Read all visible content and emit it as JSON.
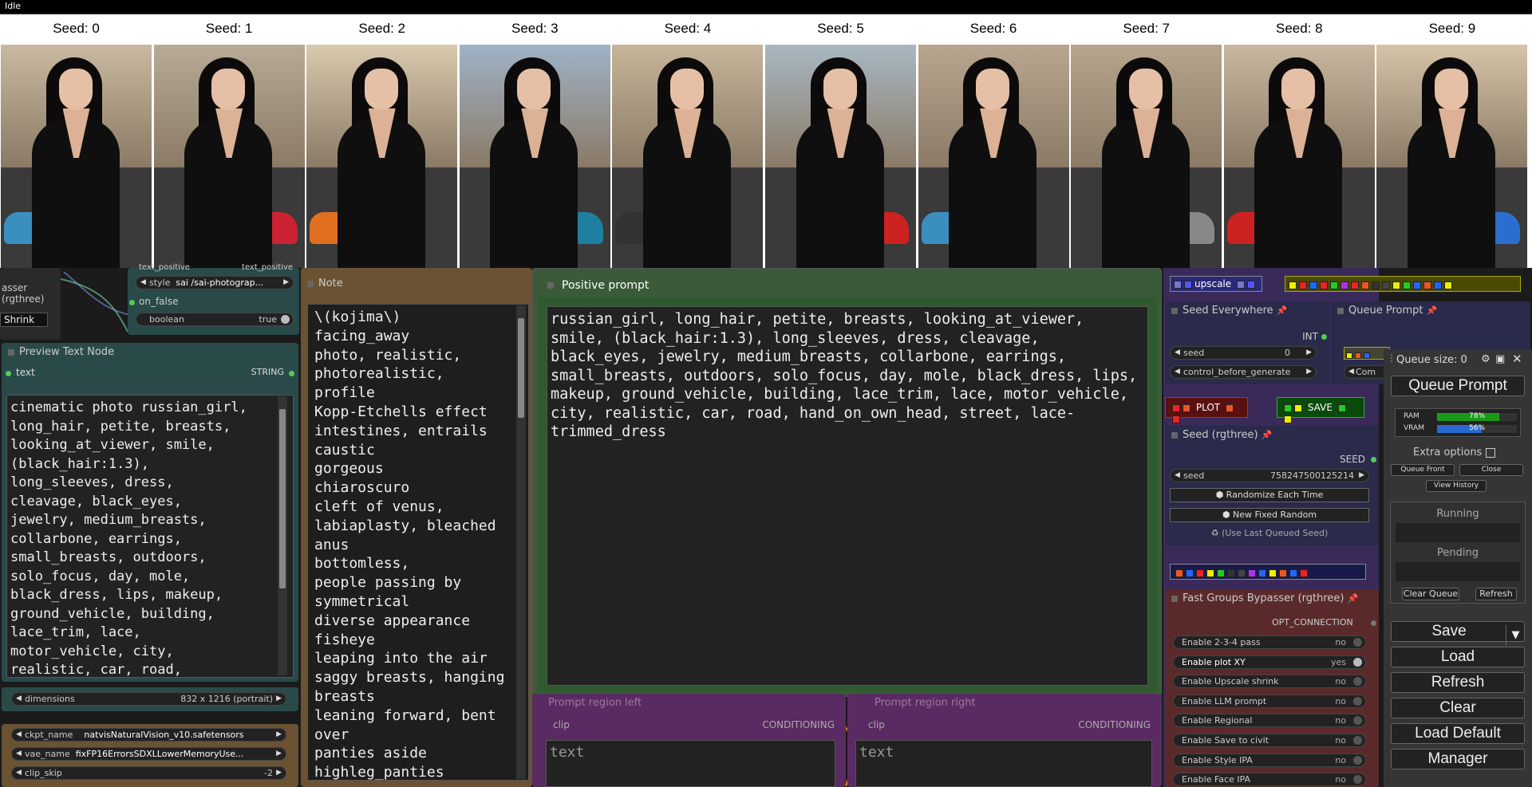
{
  "window": {
    "status": "Idle"
  },
  "grid": {
    "seeds": [
      "Seed: 0",
      "Seed: 1",
      "Seed: 2",
      "Seed: 3",
      "Seed: 4",
      "Seed: 5",
      "Seed: 6",
      "Seed: 7",
      "Seed: 8",
      "Seed: 9"
    ]
  },
  "left": {
    "bypass_title": "asser (rgthree)",
    "shrink_label": "Shrink",
    "bypass_cut": "ypasser (rgthree)",
    "text_positive_in": "text_positive",
    "text_positive_out": "text_positive",
    "style_label": "style",
    "style_value": "sai /sai-photograp...",
    "on_false": "on_false",
    "boolean_label": "boolean",
    "boolean_value": "true",
    "preview_title": "Preview Text Node",
    "text_input": "text",
    "string_output": "STRING",
    "preview_text": "cinematic photo russian_girl,\nlong_hair, petite, breasts,\nlooking_at_viewer, smile,\n(black_hair:1.3),\nlong_sleeves, dress,\ncleavage, black_eyes,\njewelry, medium_breasts,\ncollarbone, earrings,\nsmall_breasts, outdoors,\nsolo_focus, day, mole,\nblack_dress, lips, makeup,\nground_vehicle, building,\nlace_trim, lace,\nmotor_vehicle, city,\nrealistic, car, road,",
    "dimensions_label": "dimensions",
    "dimensions_value": "832 x 1216  (portrait)",
    "ckpt_label": "ckpt_name",
    "ckpt_value": "natvisNaturalVision_v10.safetensors",
    "vae_label": "vae_name",
    "vae_value": "fixFP16ErrorsSDXLLowerMemoryUse...",
    "clip_label": "clip_skip",
    "clip_value": "-2"
  },
  "note": {
    "title": "Note",
    "text": "\\(kojima\\)\nfacing_away\nphoto, realistic,\nphotorealistic,\nprofile\nKopp-Etchells effect\nintestines, entrails\ncaustic\ngorgeous\nchiaroscuro\ncleft of venus,\nlabiaplasty, bleached\nanus\nbottomless,\npeople passing by\nsymmetrical\ndiverse appearance\nfisheye\nleaping into the air\nsaggy breasts, hanging\nbreasts\nleaning forward, bent\nover\npanties aside\nhighleg_panties"
  },
  "positive": {
    "title": "Positive prompt",
    "text": "russian_girl, long_hair, petite, breasts, looking_at_viewer,\nsmile, (black_hair:1.3), long_sleeves, dress, cleavage,\nblack_eyes, jewelry, medium_breasts, collarbone, earrings,\nsmall_breasts, outdoors, solo_focus, day, mole, black_dress, lips,\nmakeup, ground_vehicle, building, lace_trim, lace, motor_vehicle,\ncity, realistic, car, road, hand_on_own_head, street, lace-\ntrimmed_dress"
  },
  "regions": {
    "left_title": "Prompt region left",
    "right_title": "Prompt region right",
    "clip": "clip",
    "conditioning": "CONDITIONING",
    "placeholder": "text"
  },
  "right": {
    "upscale_label": "upscale",
    "seed_everywhere_title": "Seed Everywhere",
    "int_label": "INT",
    "seed_label": "seed",
    "seed_value": "0",
    "control_label": "control_before_generate",
    "queue_prompt_node": "Queue Prompt",
    "com_label": "Com",
    "plot_label": "PLOT",
    "save_label": "SAVE",
    "seed_rg_title": "Seed (rgthree)",
    "seed_out": "SEED",
    "seed_rg_label": "seed",
    "seed_rg_value": "758247500125214",
    "randomize": "Randomize Each Time",
    "new_fixed": "New Fixed Random",
    "use_last": "(Use Last Queued Seed)",
    "fgb_title": "Fast Groups Bypasser (rgthree)",
    "opt_conn": "OPT_CONNECTION",
    "toggles": [
      {
        "label": "Enable 2-3-4 pass",
        "value": "no"
      },
      {
        "label": "Enable plot XY",
        "value": "yes"
      },
      {
        "label": "Enable Upscale shrink",
        "value": "no"
      },
      {
        "label": "Enable LLM prompt",
        "value": "no"
      },
      {
        "label": "Enable Regional",
        "value": "no"
      },
      {
        "label": "Enable Save to civit",
        "value": "no"
      },
      {
        "label": "Enable Style IPA",
        "value": "no"
      },
      {
        "label": "Enable Face IPA",
        "value": "no"
      }
    ]
  },
  "queue": {
    "size_label": "Queue size: 0",
    "queue_button": "Queue Prompt",
    "ram_label": "RAM",
    "ram_value": "78%",
    "ram_fraction": 0.78,
    "vram_label": "VRAM",
    "vram_value": "56%",
    "vram_fraction": 0.56,
    "extra_options": "Extra options",
    "queue_front": "Queue Front",
    "close": "Close",
    "view_history": "View History",
    "running": "Running",
    "pending": "Pending",
    "clear_queue": "Clear Queue",
    "refresh_small": "Refresh",
    "buttons": [
      "Save",
      "Load",
      "Refresh",
      "Clear",
      "Load Default",
      "Manager"
    ]
  },
  "colors": {
    "canvas": "#1b1b1b",
    "positive_group": "#3a5a3a",
    "note_group": "#6b5232",
    "region_group": "#5a2a62",
    "right_group": "#3a2a5a",
    "preview_group": "#2a4a4a"
  }
}
